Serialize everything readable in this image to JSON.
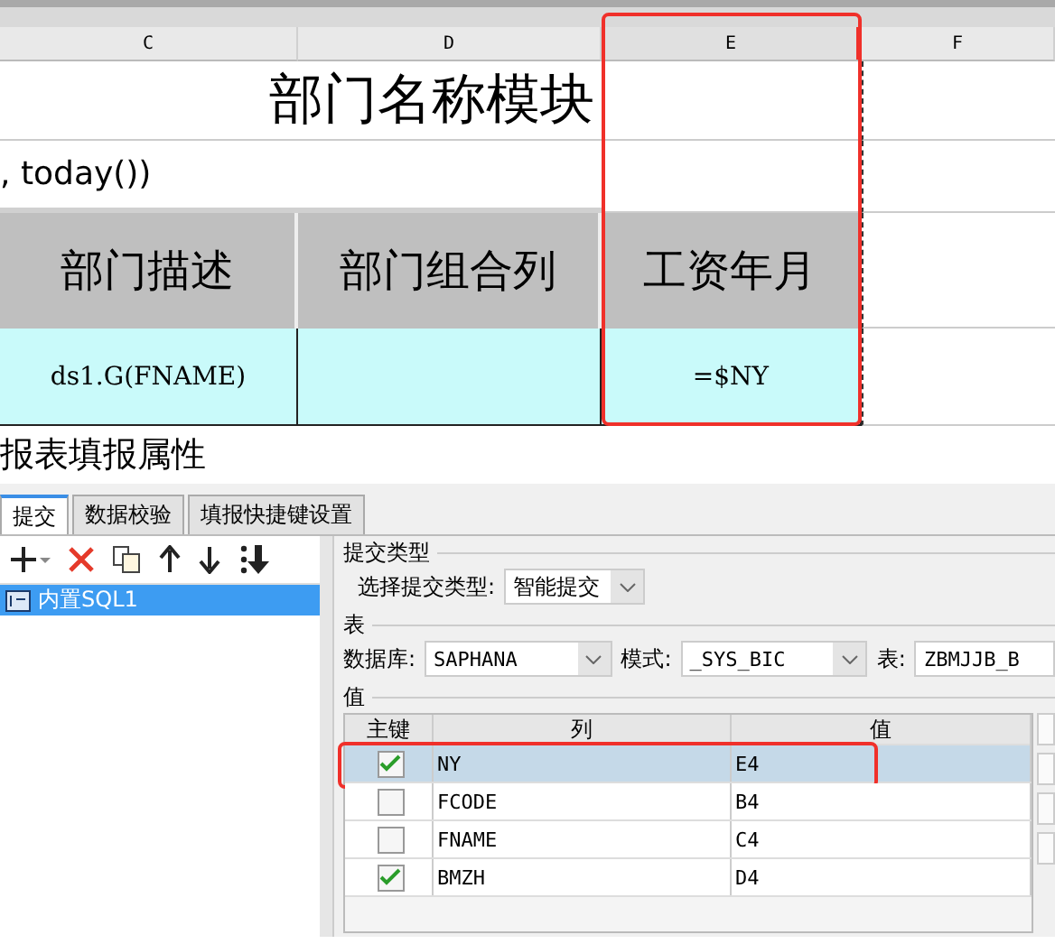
{
  "spreadsheet": {
    "columns": [
      {
        "label": "C",
        "highlighted": false
      },
      {
        "label": "D",
        "highlighted": false
      },
      {
        "label": "E",
        "highlighted": true
      },
      {
        "label": "F",
        "highlighted": false
      }
    ],
    "title": "部门名称模块",
    "formula": ", today())",
    "headers": [
      "部门描述",
      "部门组合列",
      "工资年月"
    ],
    "cells": [
      {
        "text": "ds1.G(FNAME)"
      },
      {},
      {
        "text": "=$NY"
      }
    ]
  },
  "dialog": {
    "title": "报表填报属性",
    "tabs": [
      {
        "label": "提交",
        "selected": true
      },
      {
        "label": "数据校验",
        "selected": false
      },
      {
        "label": "填报快捷键设置",
        "selected": false
      }
    ],
    "tree": [
      {
        "label": "内置SQL1",
        "selected": true
      }
    ],
    "submit_section": "提交类型",
    "submit_type_label": "选择提交类型:",
    "submit_type": "智能提交",
    "table_section": "表",
    "database_label": "数据库:",
    "database": "SAPHANA",
    "schema_label": "模式:",
    "schema": "_SYS_BIC",
    "table_label": "表:",
    "table": "ZBMJJB_B",
    "values_section": "值",
    "grid_columns": [
      "主键",
      "列",
      "值"
    ],
    "rows": [
      {
        "key": true,
        "column": "NY",
        "value": "E4",
        "selected": true,
        "highlighted": true
      },
      {
        "key": false,
        "column": "FCODE",
        "value": "B4",
        "selected": false,
        "highlighted": false
      },
      {
        "key": false,
        "column": "FNAME",
        "value": "C4",
        "selected": false,
        "highlighted": false
      },
      {
        "key": true,
        "column": "BMZH",
        "value": "D4",
        "selected": false,
        "highlighted": false
      }
    ]
  }
}
